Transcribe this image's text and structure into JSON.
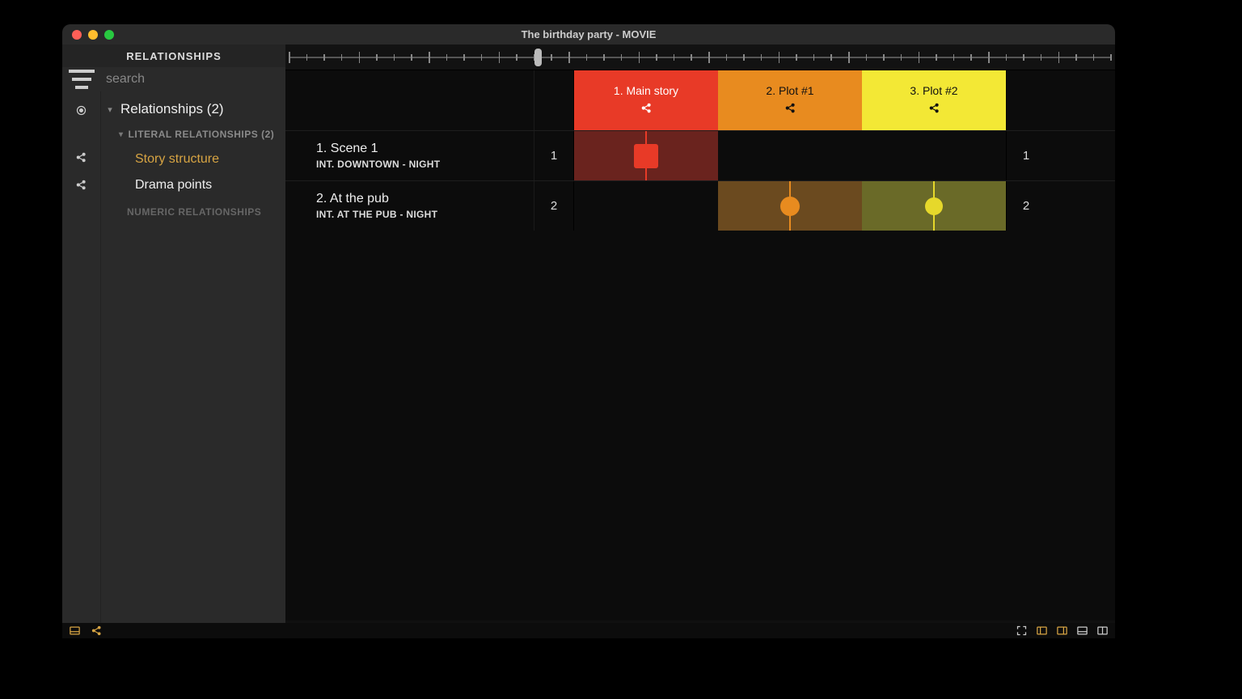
{
  "window": {
    "title": "The birthday party - MOVIE"
  },
  "sidebar": {
    "header": "RELATIONSHIPS",
    "search_placeholder": "search",
    "root": {
      "label": "Relationships (2)"
    },
    "groups": {
      "literal": {
        "label": "LITERAL RELATIONSHIPS (2)",
        "items": [
          {
            "label": "Story structure",
            "selected": true
          },
          {
            "label": "Drama points",
            "selected": false
          }
        ]
      },
      "numeric": {
        "label": "NUMERIC RELATIONSHIPS"
      }
    }
  },
  "plots": [
    {
      "label": "1. Main story",
      "color": "red"
    },
    {
      "label": "2. Plot #1",
      "color": "orange"
    },
    {
      "label": "3. Plot #2",
      "color": "yellow"
    }
  ],
  "scenes": [
    {
      "num_left": "1",
      "title": "1. Scene 1",
      "slug": "INT.  DOWNTOWN - NIGHT",
      "num_right": "1",
      "cells": [
        {
          "fill": "darkred",
          "marker": "square"
        },
        {
          "fill": "none"
        },
        {
          "fill": "none"
        }
      ]
    },
    {
      "num_left": "2",
      "title": "2. At the pub",
      "slug": "INT.  AT THE PUB - NIGHT",
      "num_right": "2",
      "cells": [
        {
          "fill": "none"
        },
        {
          "fill": "darkorange",
          "marker": "circle-orange"
        },
        {
          "fill": "olive",
          "marker": "circle-yellow"
        }
      ]
    }
  ],
  "mainbar": {
    "label": "Story structure"
  },
  "ruler": {
    "ticks": 48,
    "handle_pct": 30
  }
}
